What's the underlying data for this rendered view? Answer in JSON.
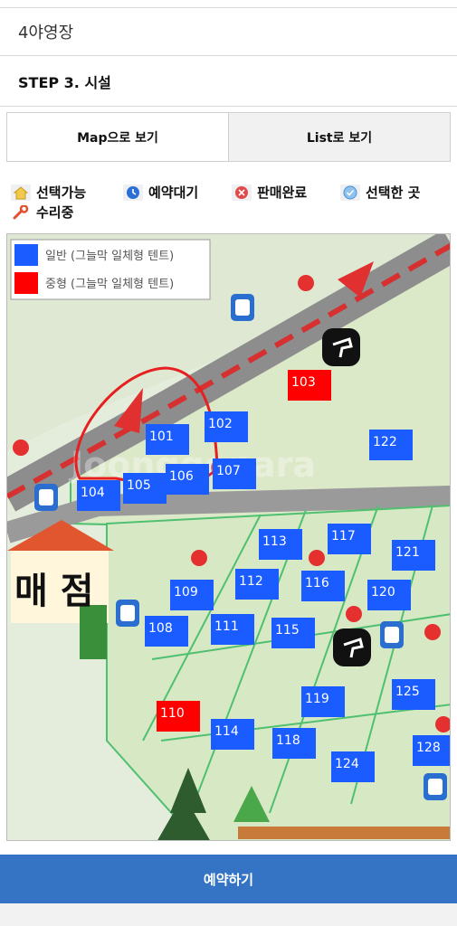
{
  "site_name": "4야영장",
  "step_title": "STEP 3. 시설",
  "tabs": [
    {
      "label": "Map으로 보기",
      "active": true
    },
    {
      "label": "List로 보기",
      "active": false
    }
  ],
  "legend": [
    {
      "label": "선택가능",
      "icon": "house-icon"
    },
    {
      "label": "예약대기",
      "icon": "clock-icon"
    },
    {
      "label": "판매완료",
      "icon": "x-circle-icon"
    },
    {
      "label": "선택한 곳",
      "icon": "check-circle-icon"
    },
    {
      "label": "수리중",
      "icon": "wrench-icon"
    }
  ],
  "map": {
    "key": [
      {
        "label": "일반 (그늘막 일체형 텐트)",
        "color": "#1a5cff"
      },
      {
        "label": "중형 (그늘막 일체형 텐트)",
        "color": "#ff0000"
      }
    ],
    "store_label": "매 점",
    "watermark": "Joonggonara",
    "sites": [
      {
        "id": "101",
        "type": "normal"
      },
      {
        "id": "102",
        "type": "normal"
      },
      {
        "id": "103",
        "type": "medium"
      },
      {
        "id": "104",
        "type": "normal"
      },
      {
        "id": "105",
        "type": "normal"
      },
      {
        "id": "106",
        "type": "normal"
      },
      {
        "id": "107",
        "type": "normal"
      },
      {
        "id": "108",
        "type": "normal"
      },
      {
        "id": "109",
        "type": "normal"
      },
      {
        "id": "110",
        "type": "medium"
      },
      {
        "id": "111",
        "type": "normal"
      },
      {
        "id": "112",
        "type": "normal"
      },
      {
        "id": "113",
        "type": "normal"
      },
      {
        "id": "114",
        "type": "normal"
      },
      {
        "id": "115",
        "type": "normal"
      },
      {
        "id": "116",
        "type": "normal"
      },
      {
        "id": "117",
        "type": "normal"
      },
      {
        "id": "118",
        "type": "normal"
      },
      {
        "id": "119",
        "type": "normal"
      },
      {
        "id": "120",
        "type": "normal"
      },
      {
        "id": "121",
        "type": "normal"
      },
      {
        "id": "122",
        "type": "normal"
      },
      {
        "id": "124",
        "type": "normal"
      },
      {
        "id": "125",
        "type": "normal"
      },
      {
        "id": "128",
        "type": "normal"
      }
    ]
  },
  "colors": {
    "normal": "#1a5cff",
    "medium": "#ff0000",
    "button": "#3574c4"
  },
  "reserve_button": "예약하기"
}
